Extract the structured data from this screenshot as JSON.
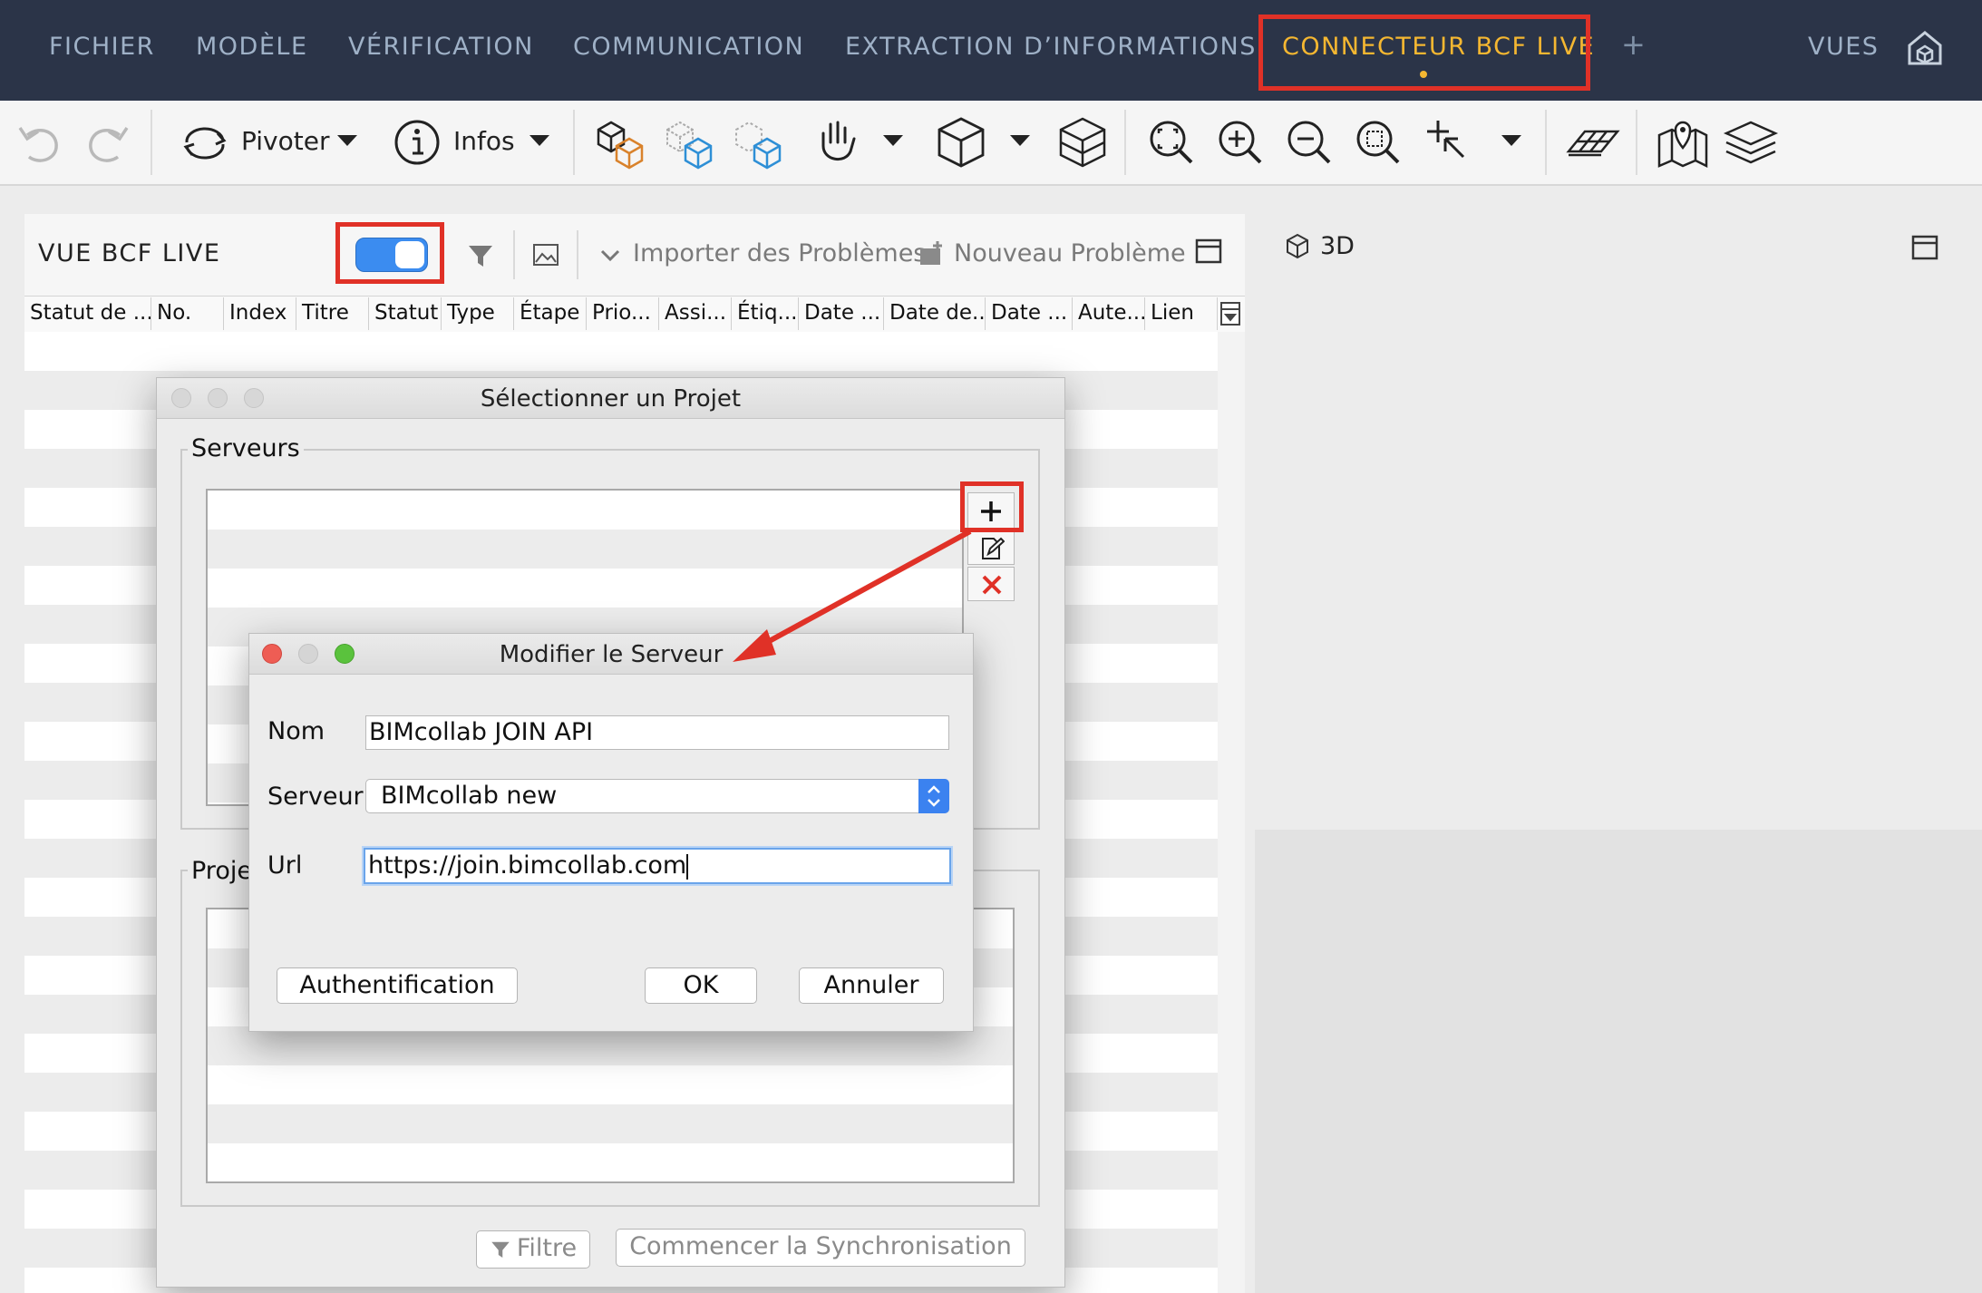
{
  "menu": {
    "items": [
      "FICHIER",
      "MODÈLE",
      "VÉRIFICATION",
      "COMMUNICATION",
      "EXTRACTION D’INFORMATIONS",
      "CONNECTEUR BCF LIVE"
    ],
    "plus": "+",
    "views": "VUES"
  },
  "toolbar": {
    "rotate_label": "Pivoter",
    "info_label": "Infos"
  },
  "bcf_panel": {
    "title": "VUE BCF LIVE",
    "import_label": "Importer des Problèmes",
    "new_issue_label": "Nouveau Problème",
    "columns": [
      "Statut de ...",
      "No.",
      "Index",
      "Titre",
      "Statut",
      "Type",
      "Étape",
      "Prio...",
      "Assi...",
      "Étiq...",
      "Date ...",
      "Date de...",
      "Date ...",
      "Aute...",
      "Lien"
    ]
  },
  "view3d": {
    "label": "3D"
  },
  "select_project": {
    "title": "Sélectionner un Projet",
    "servers_label": "Serveurs",
    "projects_label_partial": "Proje",
    "filter_label": "Filtre",
    "sync_label": "Commencer la Synchronisation"
  },
  "edit_server": {
    "title": "Modifier le Serveur",
    "name_label": "Nom",
    "name_value": "BIMcollab JOIN API",
    "server_label": "Serveur",
    "server_value": "BIMcollab new",
    "url_label": "Url",
    "url_value": "https://join.bimcollab.com",
    "auth_label": "Authentification",
    "ok_label": "OK",
    "cancel_label": "Annuler"
  },
  "colors": {
    "menubar": "#2b3448",
    "accent": "#f5b731",
    "highlight": "#e03127",
    "toggle": "#3b8cf0"
  }
}
